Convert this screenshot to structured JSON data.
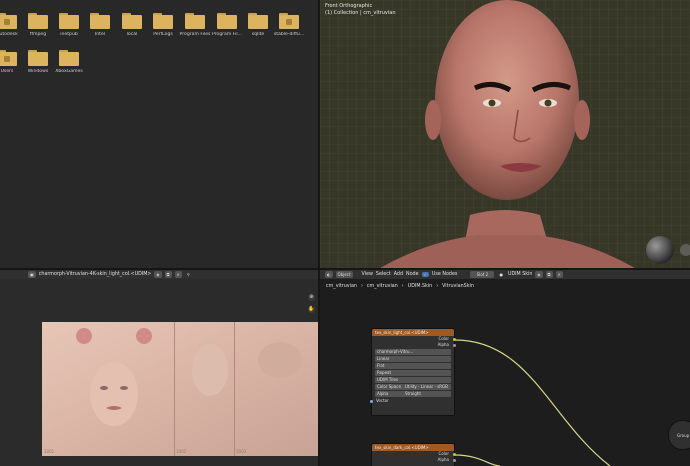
{
  "file_browser": {
    "folders": [
      {
        "label": "Autodesk"
      },
      {
        "label": "ffmpeg"
      },
      {
        "label": "inetpub"
      },
      {
        "label": "Intel"
      },
      {
        "label": "local"
      },
      {
        "label": "PerfLogs"
      },
      {
        "label": "Program Files"
      },
      {
        "label": "Program Fil..."
      },
      {
        "label": "sqlite"
      },
      {
        "label": "stable-diffu..."
      },
      {
        "label": "Users"
      },
      {
        "label": "Windows"
      },
      {
        "label": "XboxGames"
      }
    ]
  },
  "viewport": {
    "view_name": "Front Orthographic",
    "collection": "(1) Collection | cm_vitruvian"
  },
  "image_editor": {
    "image_name": "charmorph-Vitruvian-4K-skin_light_col.<UDIM>",
    "tiles": [
      "1001",
      "1002",
      "1003"
    ]
  },
  "node_editor": {
    "header": {
      "object_mode": "Object",
      "menus": [
        "View",
        "Select",
        "Add",
        "Node"
      ],
      "use_nodes_label": "Use Nodes",
      "slot": "Slot 2",
      "material": "UDIM Skin"
    },
    "breadcrumb": [
      "cm_vitruvian",
      "cm_vitruvian",
      "UDIM.Skin",
      "VitruvianSkin"
    ],
    "node1": {
      "title": "tex_skin_light_col.<UDIM>",
      "outputs": [
        "Color",
        "Alpha"
      ],
      "image": "charmorph-Vitru...",
      "interpolation": "Linear",
      "projection": "Flat",
      "extension": "Repeat",
      "source": "UDIM Tiles",
      "color_space_label": "Color Space",
      "color_space": "Utility - Linear - sRGB",
      "alpha_label": "Alpha",
      "alpha": "Straight",
      "input": "Vector"
    },
    "node2": {
      "title": "tex_skin_dark_col.<UDIM>",
      "outputs": [
        "Color",
        "Alpha"
      ]
    },
    "group_label": "Group S"
  }
}
